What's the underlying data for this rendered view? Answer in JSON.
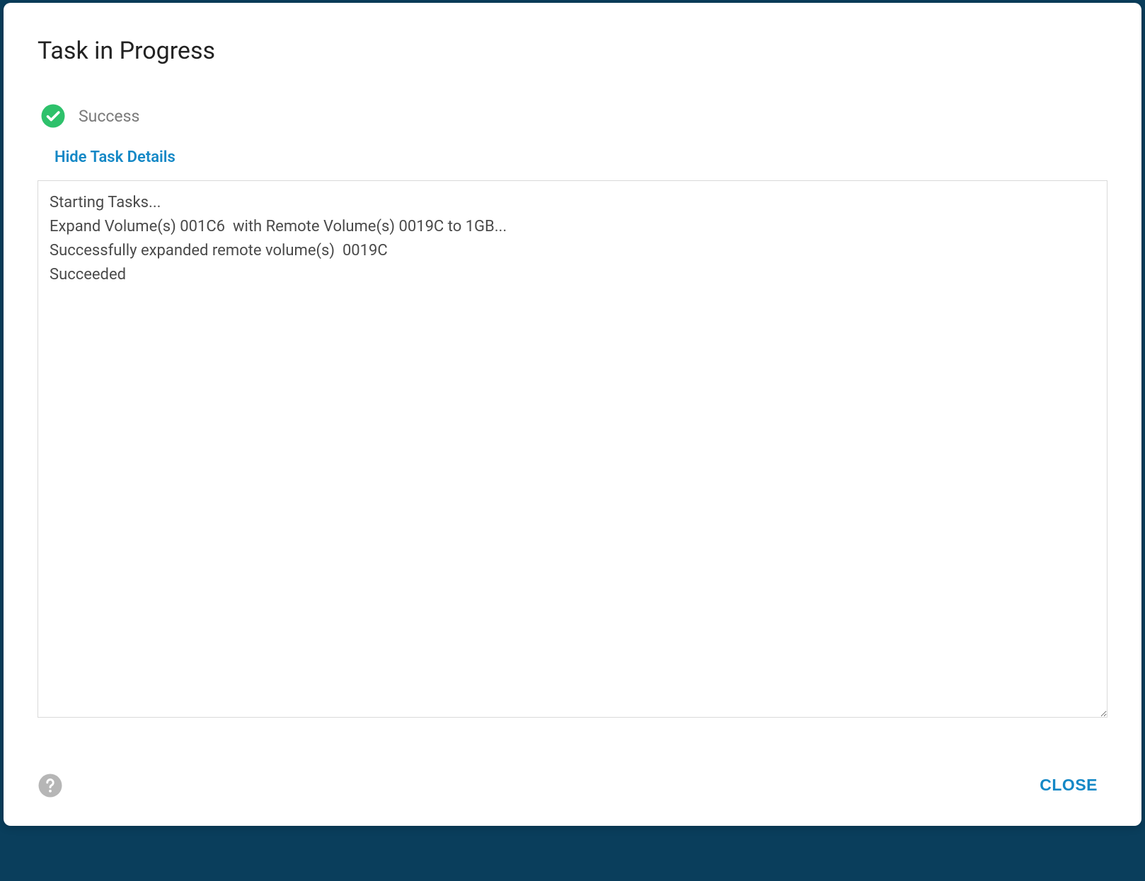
{
  "modal": {
    "title": "Task in Progress",
    "status": {
      "icon": "check-circle-icon",
      "label": "Success",
      "color": "#2ec16b"
    },
    "toggle_label": "Hide Task Details",
    "log": "Starting Tasks...\nExpand Volume(s) 001C6  with Remote Volume(s) 0019C to 1GB...\nSuccessfully expanded remote volume(s)  0019C\nSucceeded",
    "footer": {
      "help_icon": "help-icon",
      "close_label": "CLOSE"
    }
  },
  "colors": {
    "accent": "#1488c6",
    "success": "#2ec16b",
    "text_muted": "#7a7a7a",
    "border": "#d9d9d9"
  }
}
